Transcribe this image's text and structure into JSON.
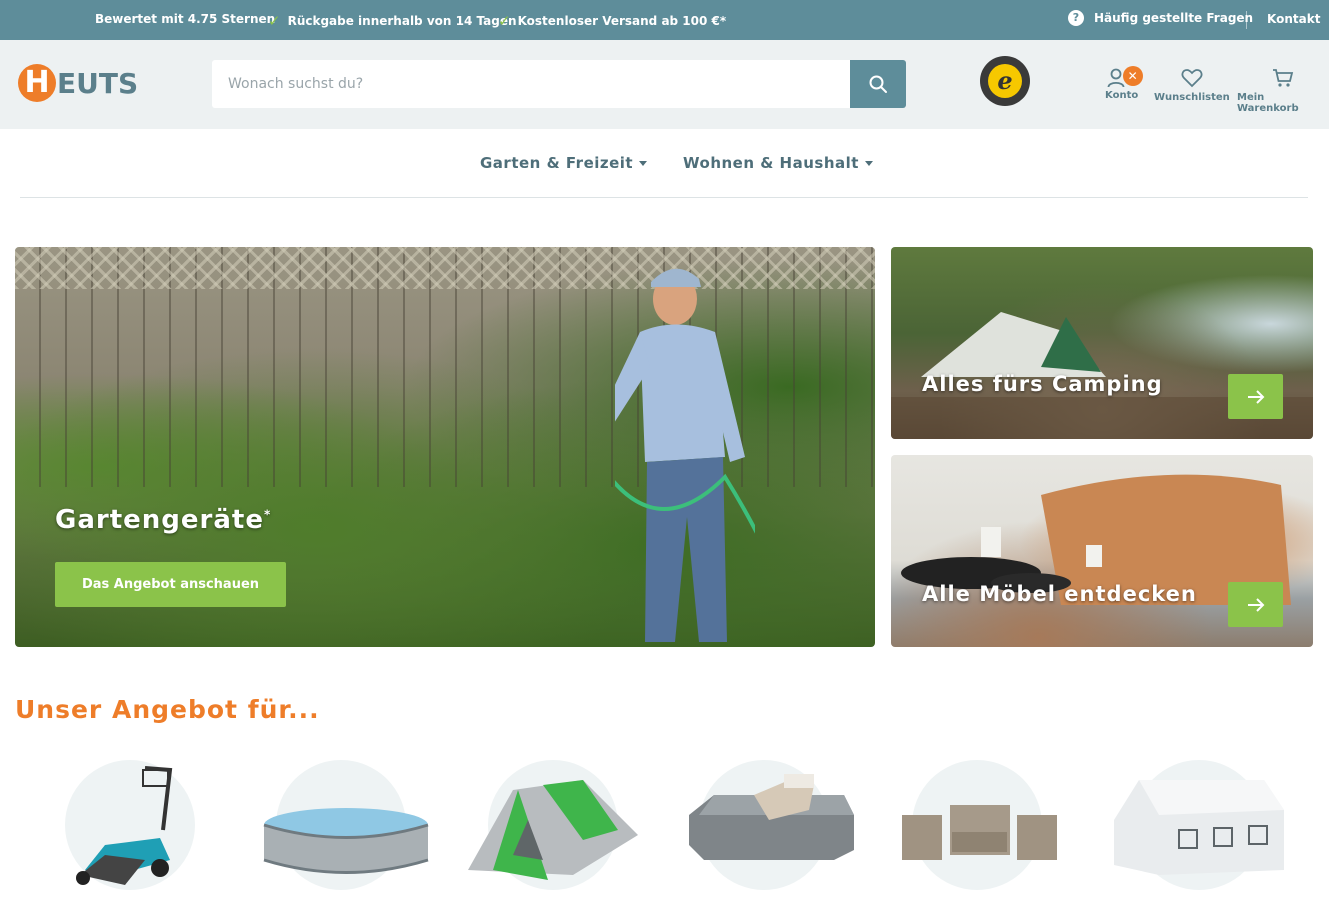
{
  "topbar": {
    "rating_prefix": "Bewertet mit ",
    "rating_value": "4.75 Sternen",
    "usp_return": "Rückgabe innerhalb von 14 Tagen",
    "usp_shipping": "Kostenloser Versand ab 100 €*",
    "faq": "Häufig gestellte Fragen",
    "contact": "Kontakt",
    "colors": {
      "bar": "#5e8d9a",
      "check": "#8bc34a"
    }
  },
  "header": {
    "logo_initial": "H",
    "logo_rest": "EUTS",
    "search_placeholder": "Wonach suchst du?",
    "trusted_letter": "e",
    "account_label": "Konto",
    "wishlist_label": "Wunschlisten",
    "cart_label": "Mein Warenkorb",
    "icons": [
      "search-icon",
      "user-icon",
      "close-icon",
      "heart-icon",
      "cart-icon"
    ]
  },
  "nav": {
    "items": [
      {
        "label": "Garten & Freizeit"
      },
      {
        "label": "Wohnen & Haushalt"
      }
    ]
  },
  "hero": {
    "title": "Gartengeräte",
    "title_mark": "*",
    "button": "Das Angebot anschauen"
  },
  "tiles": [
    {
      "title": "Alles fürs Camping"
    },
    {
      "title": "Alle Möbel entdecken"
    }
  ],
  "offers": {
    "title": "Unser Angebot für...",
    "categories": [
      "lawnmower",
      "pool",
      "tent",
      "air-mattress",
      "garden-furniture",
      "party-tent"
    ]
  },
  "colors": {
    "accent_orange": "#ee7d29",
    "accent_green": "#8bc34a",
    "brand_teal": "#5e8d9a",
    "text_teal": "#5b7f8b"
  }
}
